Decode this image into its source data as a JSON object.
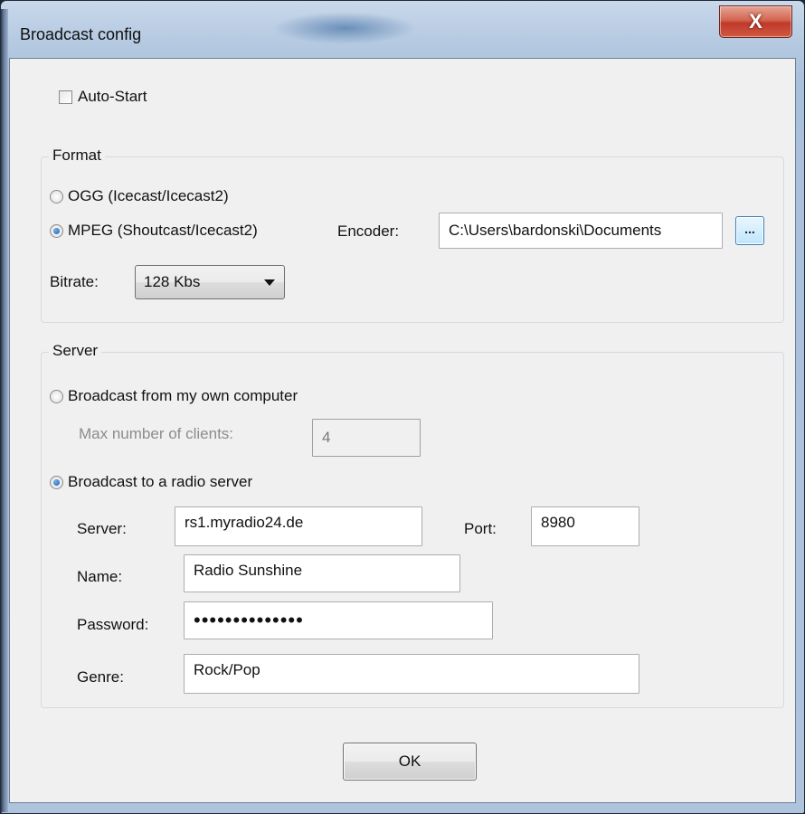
{
  "window": {
    "title": "Broadcast config",
    "close_glyph": "X"
  },
  "autostart": {
    "label": "Auto-Start",
    "checked": false
  },
  "format": {
    "title": "Format",
    "options": [
      {
        "label": "OGG (Icecast/Icecast2)",
        "selected": false
      },
      {
        "label": "MPEG (Shoutcast/Icecast2)",
        "selected": true
      }
    ],
    "encoder_label": "Encoder:",
    "encoder_value": "C:\\Users\\bardonski\\Documents",
    "browse_label": "...",
    "bitrate_label": "Bitrate:",
    "bitrate_value": "128 Kbs"
  },
  "server": {
    "title": "Server",
    "options": [
      {
        "label": "Broadcast from my own computer",
        "selected": false
      },
      {
        "label": "Broadcast to a radio server",
        "selected": true
      }
    ],
    "max_clients_label": "Max number of clients:",
    "max_clients_value": "4",
    "server_label": "Server:",
    "server_value": "rs1.myradio24.de",
    "port_label": "Port:",
    "port_value": "8980",
    "name_label": "Name:",
    "name_value": "Radio Sunshine",
    "password_label": "Password:",
    "password_value": "••••••••••••••",
    "genre_label": "Genre:",
    "genre_value": "Rock/Pop"
  },
  "ok_label": "OK"
}
